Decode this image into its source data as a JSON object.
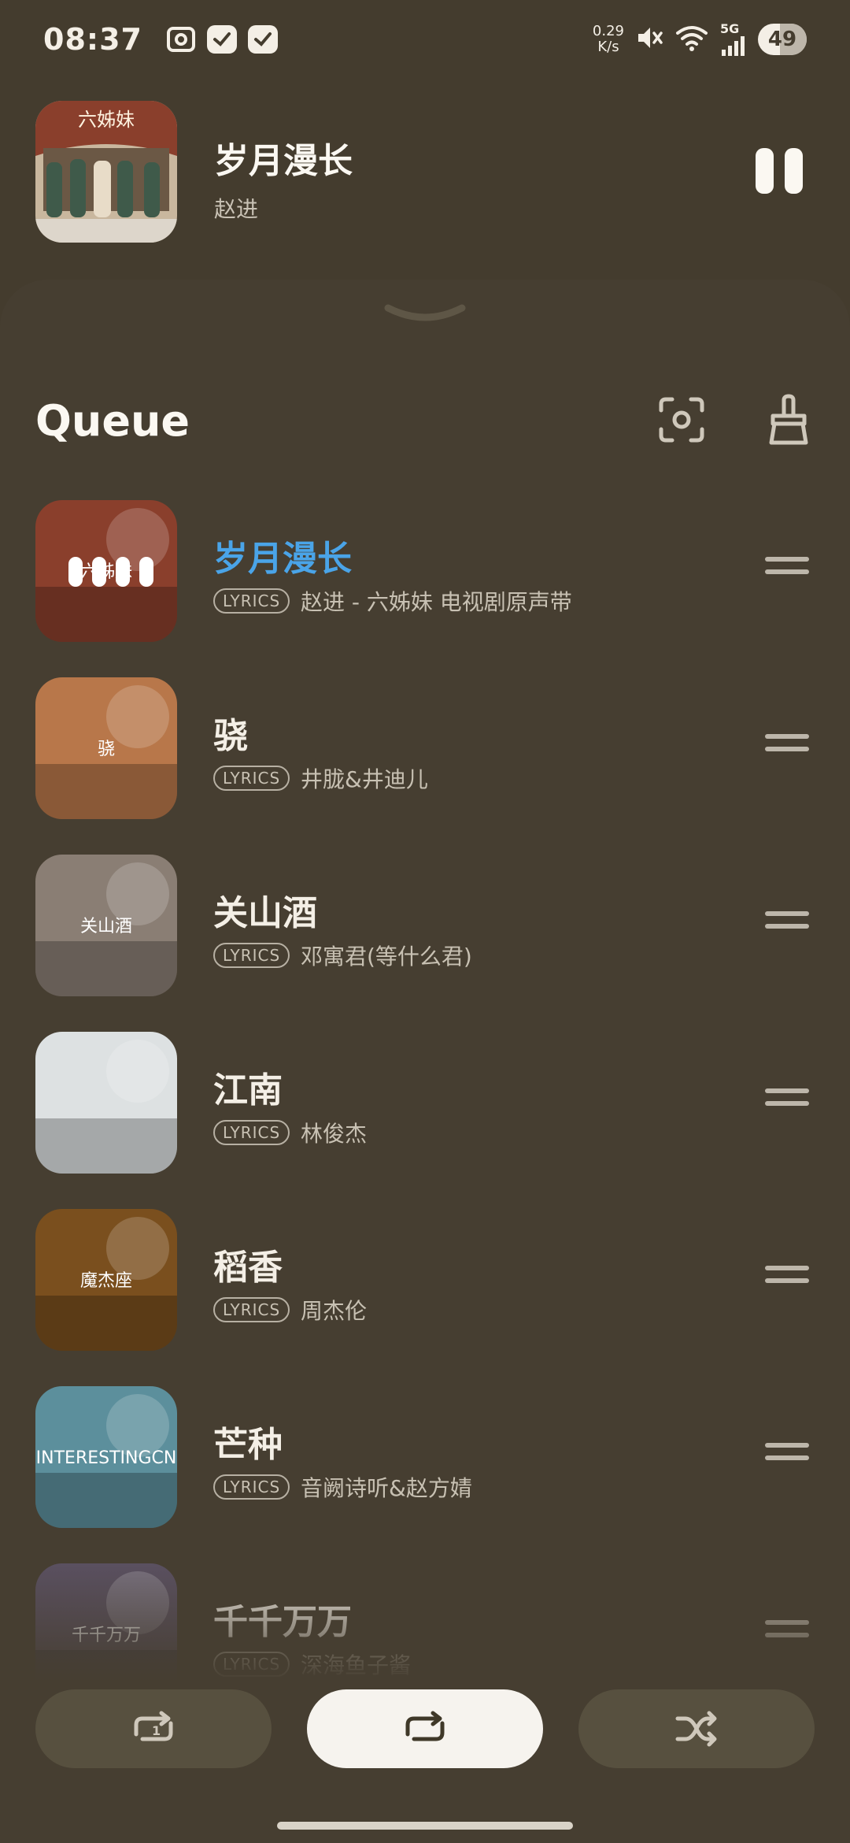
{
  "status_bar": {
    "time": "08:37",
    "notification_icons": [
      "screenshot-icon",
      "check-app-icon",
      "check-app-icon"
    ],
    "net_speed_value": "0.29",
    "net_speed_unit": "K/s",
    "signal_label": "5G",
    "battery": "49"
  },
  "now_playing": {
    "title": "岁月漫长",
    "artist": "赵进",
    "art_label": "六姊妹",
    "is_playing": true,
    "control_icon": "pause-icon"
  },
  "queue": {
    "title": "Queue",
    "actions": [
      "locate-current-icon",
      "clear-queue-icon"
    ],
    "tag_label": "LYRICS",
    "items": [
      {
        "title": "岁月漫长",
        "artist": "赵进 - 六姊妹 电视剧原声带",
        "current": true,
        "art_color": "#8a3f2c",
        "art_text": "六姊妹"
      },
      {
        "title": "骁",
        "artist": "井胧&井迪儿",
        "current": false,
        "art_color": "#b8774a",
        "art_text": "骁"
      },
      {
        "title": "关山酒",
        "artist": "邓寓君(等什么君)",
        "current": false,
        "art_color": "#8a7e74",
        "art_text": "关山酒"
      },
      {
        "title": "江南",
        "artist": "林俊杰",
        "current": false,
        "art_color": "#dde1e2",
        "art_text": ""
      },
      {
        "title": "稻香",
        "artist": "周杰伦",
        "current": false,
        "art_color": "#7a4f1e",
        "art_text": "魔杰座"
      },
      {
        "title": "芒种",
        "artist": "音阙诗听&赵方婧",
        "current": false,
        "art_color": "#5c8f9c",
        "art_text": "INTERESTINGCN"
      },
      {
        "title": "千千万万",
        "artist": "深海鱼子酱",
        "current": false,
        "art_color": "#5a5060",
        "art_text": "千千万万"
      }
    ]
  },
  "controls": {
    "repeat_one": "repeat-one-icon",
    "repeat_all": "repeat-all-icon",
    "shuffle": "shuffle-icon",
    "repeat_all_active": true
  }
}
